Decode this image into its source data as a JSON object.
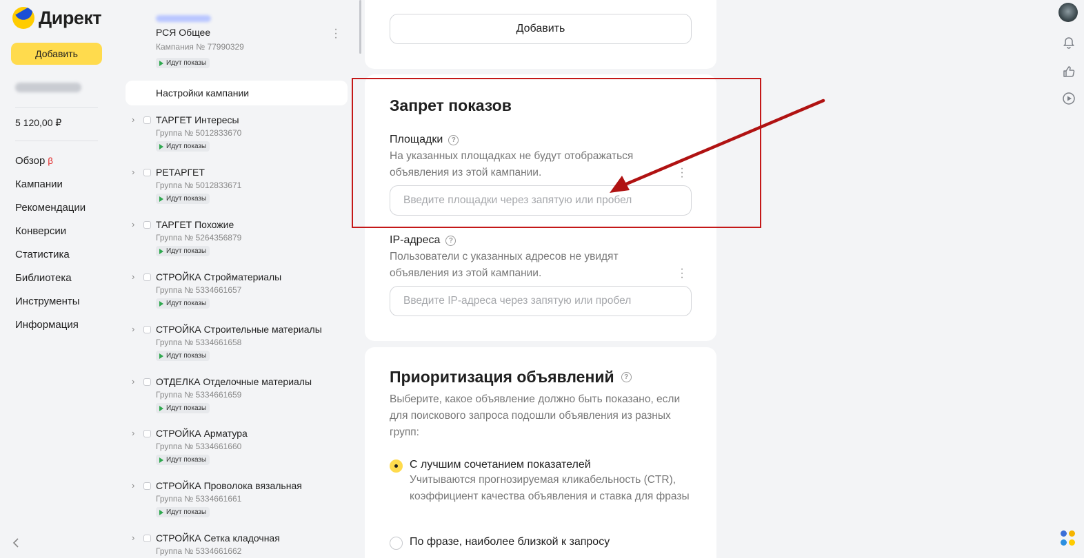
{
  "sidebar": {
    "logo_text": "Директ",
    "add_button": "Добавить",
    "balance": "5 120,00 ₽",
    "nav": [
      {
        "label": "Обзор",
        "badge": "β"
      },
      {
        "label": "Кампании"
      },
      {
        "label": "Рекомендации"
      },
      {
        "label": "Конверсии"
      },
      {
        "label": "Статистика"
      },
      {
        "label": "Библиотека"
      },
      {
        "label": "Инструменты"
      },
      {
        "label": "Информация"
      }
    ],
    "collapse_icon": "chevron-left-icon"
  },
  "tree": {
    "campaign": {
      "name": "РСЯ Общее",
      "number": "Кампания № 77990329",
      "status": "Идут показы"
    },
    "settings_label": "Настройки кампании",
    "groups": [
      {
        "name": "ТАРГЕТ Интересы",
        "number": "Группа № 5012833670",
        "status": "Идут показы"
      },
      {
        "name": "РЕТАРГЕТ",
        "number": "Группа № 5012833671",
        "status": "Идут показы"
      },
      {
        "name": "ТАРГЕТ Похожие",
        "number": "Группа № 5264356879",
        "status": "Идут показы"
      },
      {
        "name": "СТРОЙКА Стройматериалы",
        "number": "Группа № 5334661657",
        "status": "Идут показы"
      },
      {
        "name": "СТРОЙКА Строительные материалы",
        "number": "Группа № 5334661658",
        "status": "Идут показы"
      },
      {
        "name": "ОТДЕЛКА Отделочные материалы",
        "number": "Группа № 5334661659",
        "status": "Идут показы"
      },
      {
        "name": "СТРОЙКА Арматура",
        "number": "Группа № 5334661660",
        "status": "Идут показы"
      },
      {
        "name": "СТРОЙКА Проволока вязальная",
        "number": "Группа № 5334661661",
        "status": "Идут показы"
      },
      {
        "name": "СТРОЙКА Сетка кладочная",
        "number": "Группа № 5334661662",
        "status": ""
      }
    ]
  },
  "main": {
    "add_button": "Добавить",
    "block": {
      "title": "Запрет показов",
      "sites_label": "Площадки",
      "sites_desc": "На указанных площадках не будут отображаться объявления из этой кампании.",
      "sites_placeholder": "Введите площадки через запятую или пробел",
      "ip_label": "IP-адреса",
      "ip_desc": "Пользователи с указанных адресов не увидят объявления из этой кампании.",
      "ip_placeholder": "Введите IP-адреса через запятую или пробел"
    },
    "priority": {
      "title": "Приоритизация объявлений",
      "desc": "Выберите, какое объявление должно быть показано, если для поискового запроса подошли объявления из разных групп:",
      "option1_label": "С лучшим сочетанием показателей",
      "option1_desc": "Учитываются прогнозируемая кликабельность (CTR), коэффициент качества объявления и ставка для фразы",
      "option2_label": "По фразе, наиболее близкой к запросу"
    }
  },
  "rail": {
    "icons": [
      "bell-icon",
      "thumbs-up-icon",
      "play-icon"
    ]
  },
  "colors": {
    "accent": "#ffdb4d",
    "annotation": "#c41818",
    "status_green": "#2fa84f"
  }
}
